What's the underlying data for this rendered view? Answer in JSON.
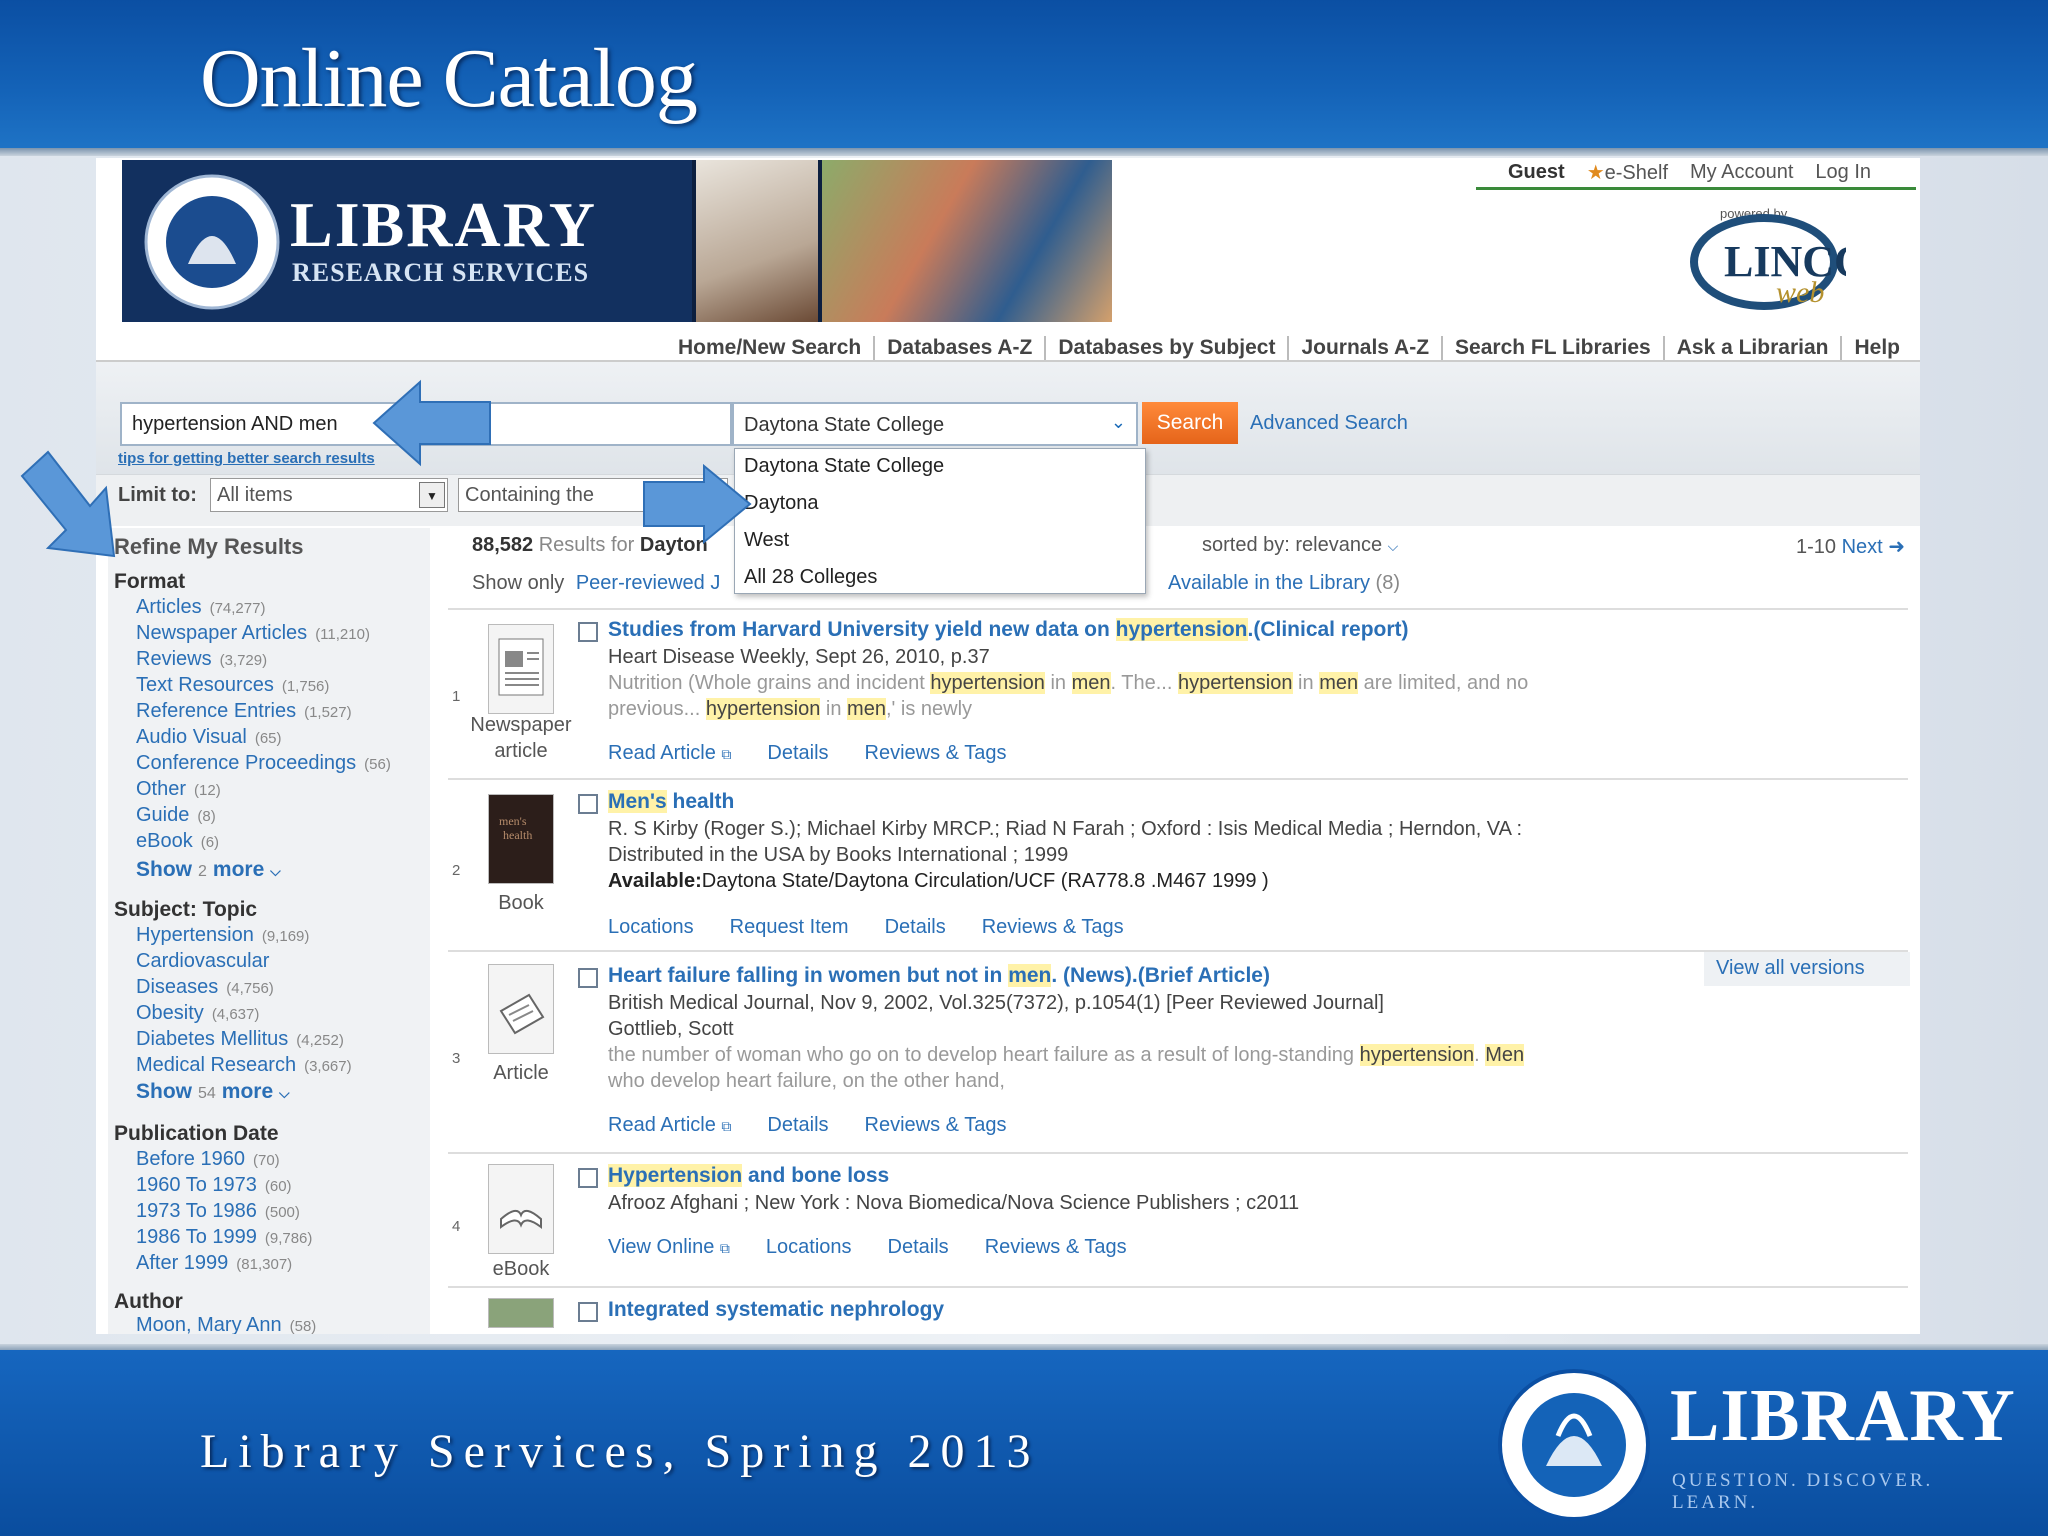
{
  "slide": {
    "title": "Online Catalog",
    "footer": "Library Services, Spring 2013",
    "logo_word": "LIBRARY",
    "logo_tagline": "QUESTION. DISCOVER. LEARN."
  },
  "banner": {
    "word": "LIBRARY",
    "sub": "RESEARCH SERVICES",
    "powered_by": "powered by"
  },
  "userbar": {
    "guest": "Guest",
    "eshelf": "e-Shelf",
    "account": "My Account",
    "login": "Log In"
  },
  "nav": [
    "Home/New Search",
    "Databases A-Z",
    "Databases by Subject",
    "Journals A-Z",
    "Search FL Libraries",
    "Ask a Librarian",
    "Help"
  ],
  "search": {
    "query": "hypertension AND men",
    "scope": "Daytona State College",
    "button": "Search",
    "advanced": "Advanced Search",
    "tips": "tips for getting better search results",
    "limit_label": "Limit to:",
    "limit_value": "All items",
    "contain_value": "Containing the"
  },
  "scope_options": [
    "Daytona State College",
    "Daytona",
    "West",
    "All 28 Colleges"
  ],
  "facets": {
    "title": "Refine My Results",
    "format_head": "Format",
    "format": [
      {
        "label": "Articles",
        "count": "(74,277)"
      },
      {
        "label": "Newspaper Articles",
        "count": "(11,210)"
      },
      {
        "label": "Reviews",
        "count": "(3,729)"
      },
      {
        "label": "Text Resources",
        "count": "(1,756)"
      },
      {
        "label": "Reference Entries",
        "count": "(1,527)"
      },
      {
        "label": "Audio Visual",
        "count": "(65)"
      },
      {
        "label": "Conference Proceedings",
        "count": "(56)"
      },
      {
        "label": "Other",
        "count": "(12)"
      },
      {
        "label": "Guide",
        "count": "(8)"
      },
      {
        "label": "eBook",
        "count": "(6)"
      }
    ],
    "format_more": {
      "show": "Show",
      "num": "2",
      "more": "more"
    },
    "subject_head": "Subject: Topic",
    "subject": [
      {
        "label": "Hypertension",
        "count": "(9,169)"
      },
      {
        "label": "Cardiovascular",
        "count": ""
      },
      {
        "label": "Diseases",
        "count": "(4,756)"
      },
      {
        "label": "Obesity",
        "count": "(4,637)"
      },
      {
        "label": "Diabetes Mellitus",
        "count": "(4,252)"
      },
      {
        "label": "Medical Research",
        "count": "(3,667)"
      }
    ],
    "subject_more": {
      "show": "Show",
      "num": "54",
      "more": "more"
    },
    "date_head": "Publication Date",
    "dates": [
      {
        "label": "Before 1960",
        "count": "(70)"
      },
      {
        "label": "1960 To 1973",
        "count": "(60)"
      },
      {
        "label": "1973 To 1986",
        "count": "(500)"
      },
      {
        "label": "1986 To 1999",
        "count": "(9,786)"
      },
      {
        "label": "After 1999",
        "count": "(81,307)"
      }
    ],
    "author_head": "Author",
    "authors": [
      {
        "label": "Moon, Mary Ann",
        "count": "(58)"
      }
    ]
  },
  "results_header": {
    "count": "88,582",
    "results_for": "Results for",
    "scope_partial": "Dayton",
    "sorted_label": "sorted by:",
    "sorted_value": "relevance",
    "range": "1-10",
    "next": "Next",
    "show_only": "Show only",
    "peer_reviewed": "Peer-reviewed J",
    "paren": ")",
    "available": "Available in the Library",
    "available_count": "(8)"
  },
  "results": [
    {
      "num": "1",
      "type": "Newspaper article",
      "title_parts": [
        "Studies from Harvard University yield new data on ",
        "hypertension",
        ".(Clinical report)"
      ],
      "line1": "Heart Disease Weekly, Sept 26, 2010, p.37",
      "snip1": [
        "Nutrition (Whole grains and incident ",
        "hypertension",
        " in ",
        "men",
        ". The... ",
        "hypertension",
        " in ",
        "men",
        " are limited, and no"
      ],
      "snip2": [
        "previous... ",
        "hypertension",
        " in ",
        "men",
        ",' is newly"
      ],
      "actions": [
        "Read Article",
        "Details",
        "Reviews & Tags"
      ]
    },
    {
      "num": "2",
      "type": "Book",
      "title_parts": [
        "",
        "Men's",
        " health"
      ],
      "line1": "R. S Kirby (Roger S.); Michael Kirby MRCP.; Riad N Farah ; Oxford : Isis Medical Media ; Herndon, VA :",
      "line2": "Distributed in the USA by Books International ; 1999",
      "avail_label": "Available:",
      "avail_value": "Daytona State/Daytona Circulation/UCF (RA778.8 .M467 1999 )",
      "actions": [
        "Locations",
        "Request Item",
        "Details",
        "Reviews & Tags"
      ]
    },
    {
      "num": "3",
      "type": "Article",
      "title_parts": [
        "Heart failure falling in women but not in ",
        "men",
        ". (News).(Brief Article)"
      ],
      "line1": "British Medical Journal, Nov 9, 2002, Vol.325(7372), p.1054(1) [Peer Reviewed Journal]",
      "line2": "Gottlieb, Scott",
      "snip1": [
        "the number of woman who go on to develop heart failure as a result of long-standing ",
        "hypertension",
        ". ",
        "Men",
        ""
      ],
      "snip2": [
        "who develop heart failure, on the other hand,"
      ],
      "view_versions": "View all versions",
      "actions": [
        "Read Article",
        "Details",
        "Reviews & Tags"
      ]
    },
    {
      "num": "4",
      "type": "eBook",
      "title_parts": [
        "",
        "Hypertension",
        " and bone loss"
      ],
      "line1": "Afrooz Afghani ; New York : Nova Biomedica/Nova Science Publishers ; c2011",
      "actions": [
        "View Online",
        "Locations",
        "Details",
        "Reviews & Tags"
      ]
    },
    {
      "num": "",
      "type": "",
      "title_parts": [
        "Integrated systematic nephrology",
        "",
        ""
      ]
    }
  ]
}
